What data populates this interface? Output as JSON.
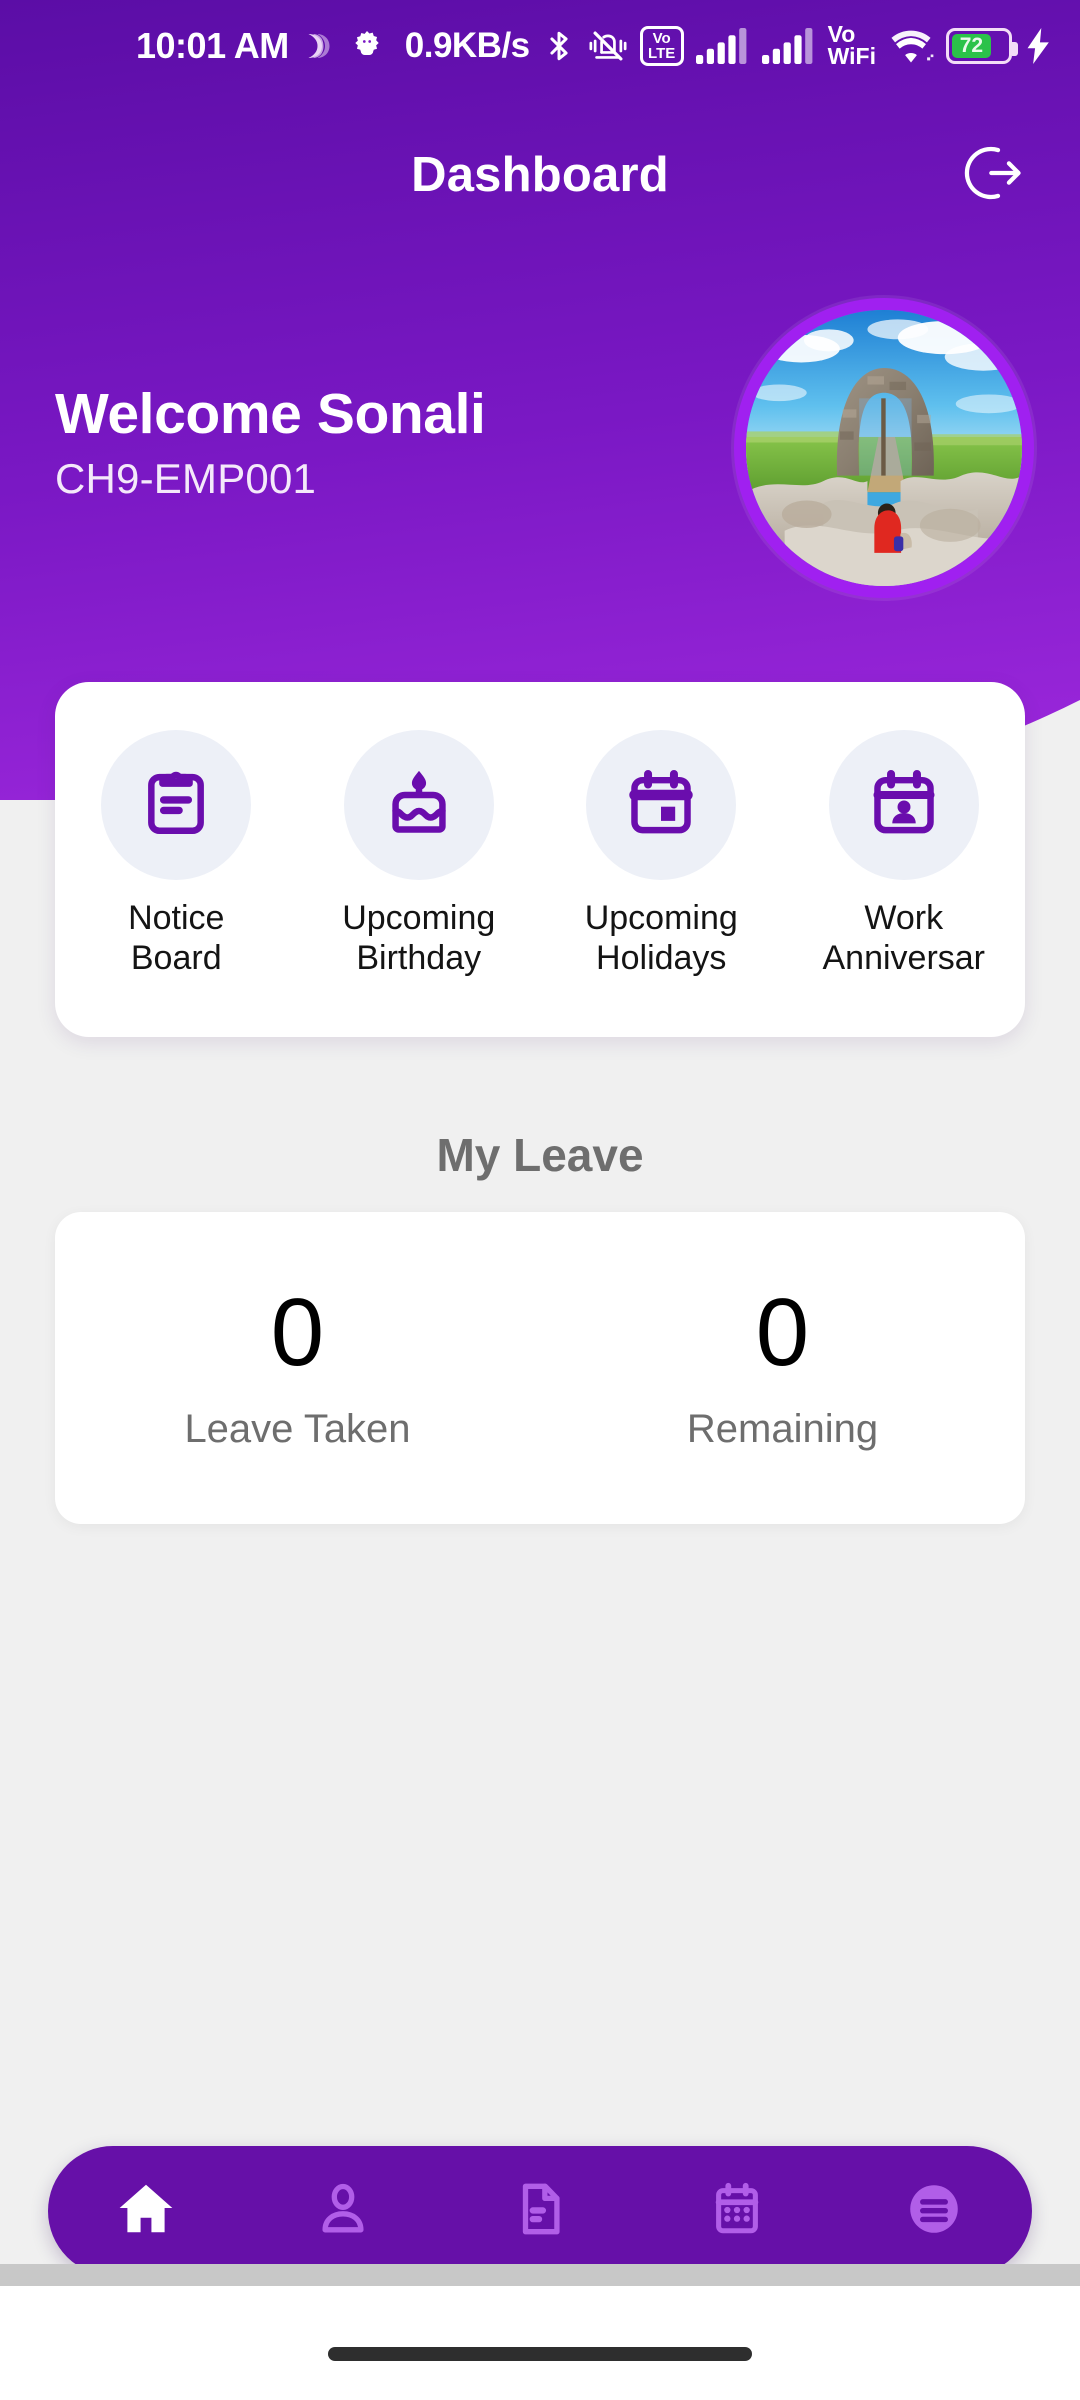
{
  "statusbar": {
    "time": "10:01 AM",
    "network_speed": "0.9KB/s",
    "icons": [
      "brightness-auto-icon",
      "android-settings-icon",
      "bluetooth-icon",
      "vibrate-off-icon",
      "volte-icon",
      "signal-bars-sim1-icon",
      "signal-bars-sim2-icon",
      "vowifi-icon",
      "wifi-icon",
      "battery-icon",
      "charging-bolt-icon"
    ],
    "volte_line1": "Vo",
    "volte_line2": "LTE",
    "vowifi_line1": "Vo",
    "vowifi_line2": "WiFi",
    "battery_percent": "72",
    "battery_level": 72,
    "charging": true
  },
  "appbar": {
    "title": "Dashboard",
    "logout_icon": "logout-icon"
  },
  "welcome": {
    "greeting": "Welcome Sonali",
    "employee_id": "CH9-EMP001",
    "avatar_alt": "stone-archway-ruin-photo"
  },
  "quick_actions": [
    {
      "label_line1": "Notice",
      "label_line2": "Board",
      "icon": "clipboard-icon"
    },
    {
      "label_line1": "Upcoming",
      "label_line2": "Birthday",
      "icon": "birthday-cake-icon"
    },
    {
      "label_line1": "Upcoming",
      "label_line2": "Holidays",
      "icon": "calendar-event-icon"
    },
    {
      "label_line1": "Work",
      "label_line2": "Anniversar",
      "icon": "calendar-person-icon"
    }
  ],
  "my_leave": {
    "title": "My Leave",
    "stats": [
      {
        "value": "0",
        "caption": "Leave Taken"
      },
      {
        "value": "0",
        "caption": "Remaining"
      }
    ]
  },
  "bottom_nav": [
    {
      "icon": "home-icon",
      "active": true
    },
    {
      "icon": "person-icon",
      "active": false
    },
    {
      "icon": "document-icon",
      "active": false
    },
    {
      "icon": "calendar-icon",
      "active": false
    },
    {
      "icon": "menu-icon",
      "active": false
    }
  ],
  "colors": {
    "header_top": "#5B0DA6",
    "header_bottom": "#9B27DB",
    "nav_bar": "#6610A8",
    "nav_icon_inactive": "#B15EE8",
    "nav_icon_active": "#FFFFFF",
    "icon_purple": "#6A0DAD",
    "icon_bg": "#EDF0F7",
    "page_bg": "#F0F0F0",
    "battery_green": "#2BC24A",
    "avatar_ring": "#A020F0"
  }
}
